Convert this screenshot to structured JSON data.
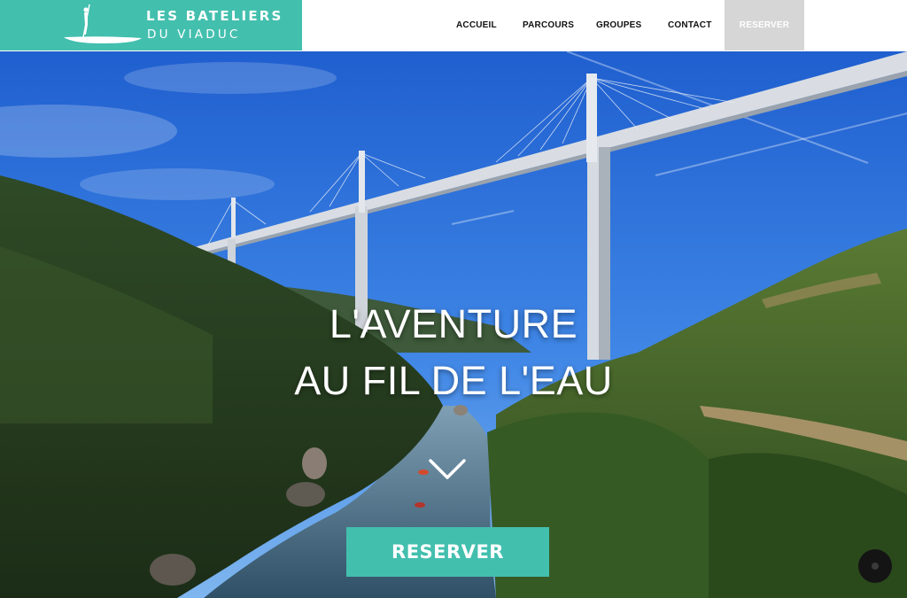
{
  "logo": {
    "title": "LES BATELIERS",
    "subtitle": "DU VIADUC",
    "icon": "paddleboard-logo-icon"
  },
  "nav": {
    "items": [
      {
        "label": "ACCUEIL"
      },
      {
        "label": "PARCOURS"
      },
      {
        "label": "GROUPES"
      },
      {
        "label": "CONTACT"
      },
      {
        "label": "RESERVER"
      }
    ]
  },
  "hero": {
    "headline_line1": "L'AVENTURE",
    "headline_line2": "AU FIL DE L'EAU",
    "cta_label": "RESERVER",
    "scroll_icon": "chevron-down-icon"
  },
  "colors": {
    "brand_teal": "#43bfae",
    "reserve_tab_bg": "#d6d6d6"
  }
}
